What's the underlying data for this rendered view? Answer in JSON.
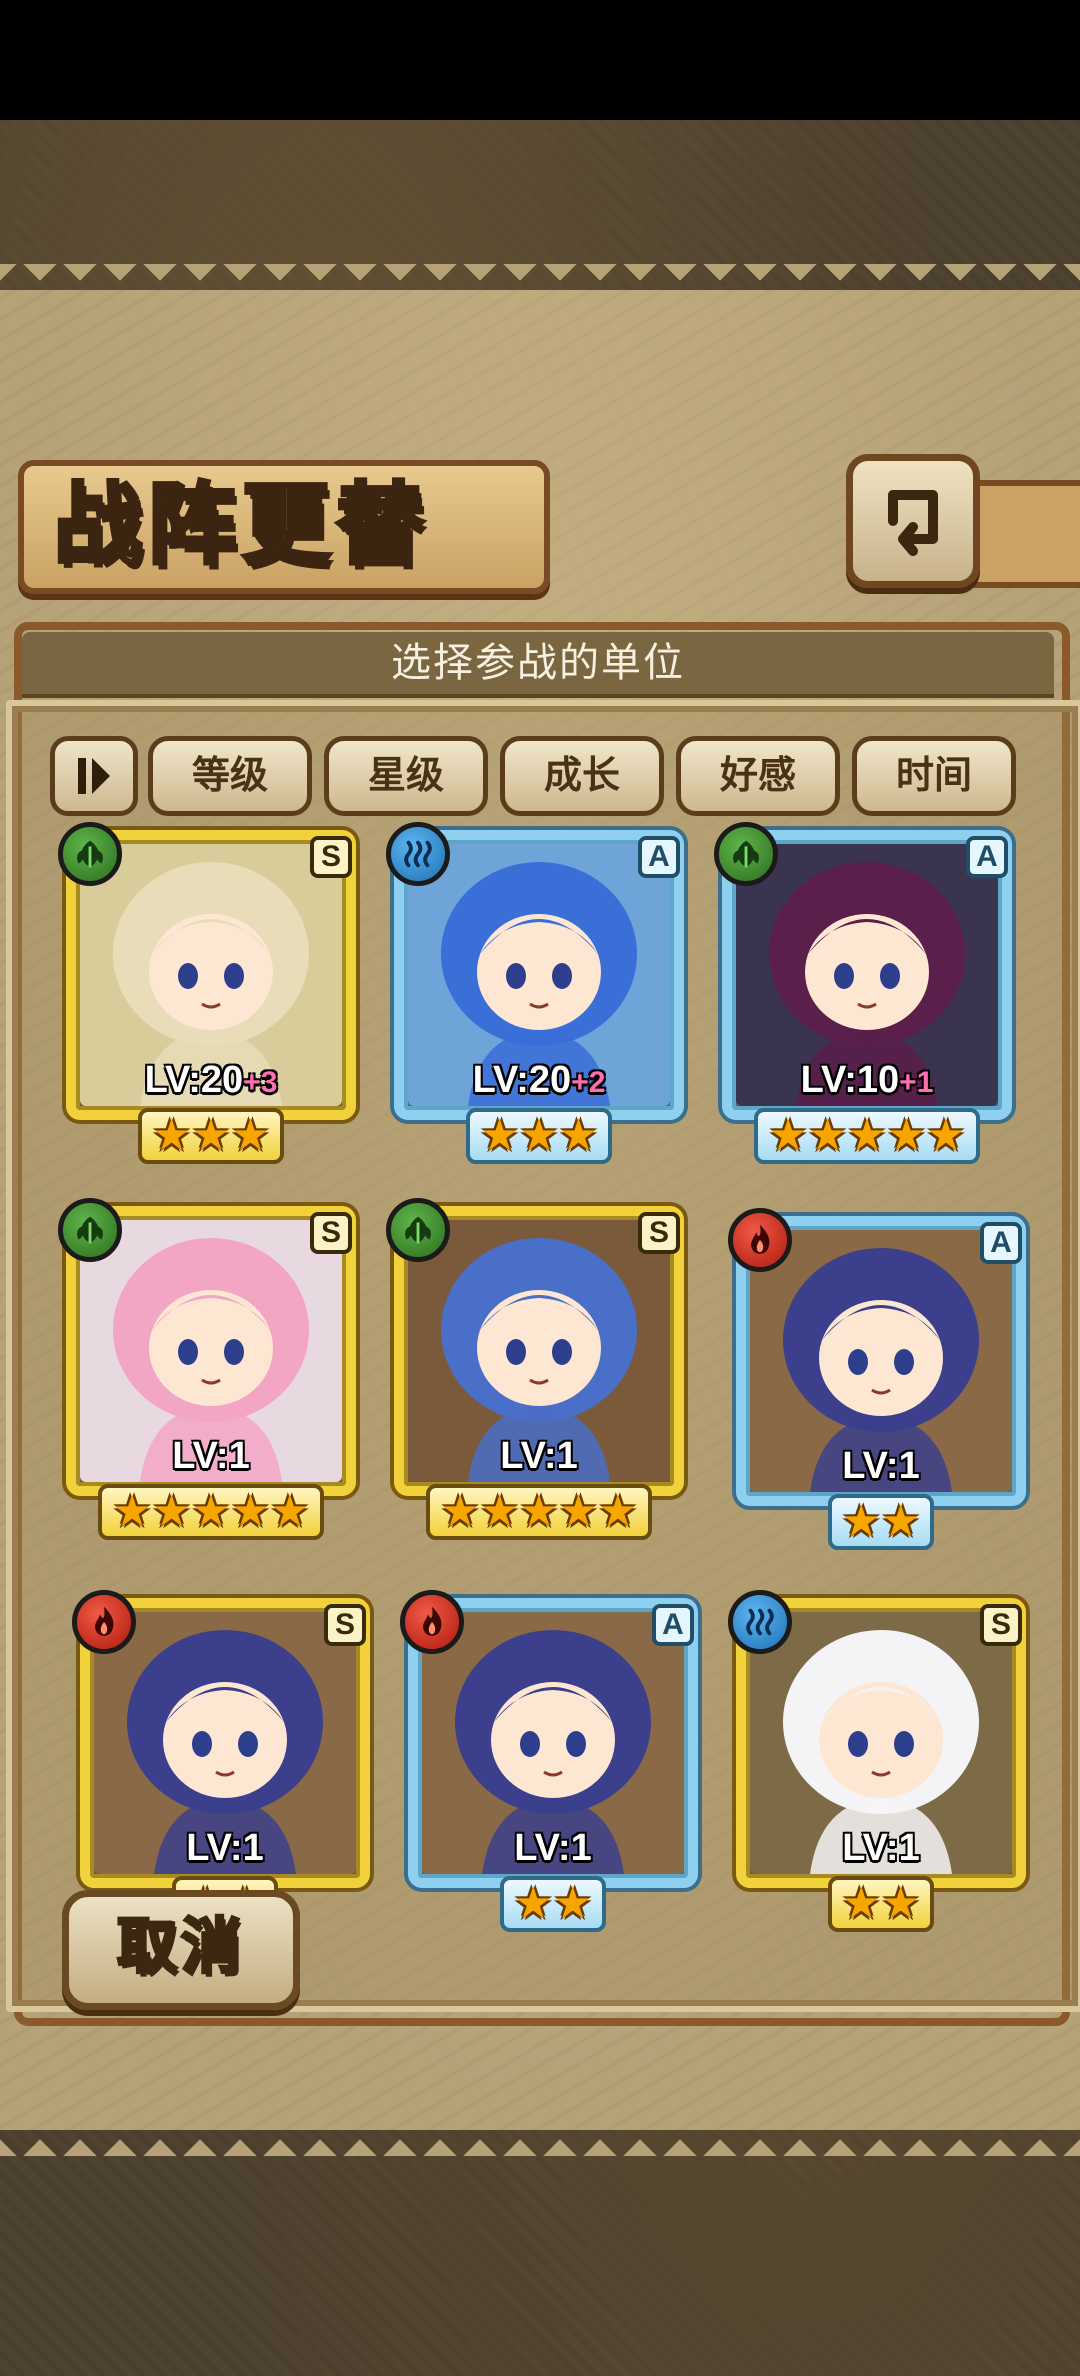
{
  "header": {
    "title": "战阵更替"
  },
  "panel": {
    "subtitle": "选择参战的单位"
  },
  "sort_chips": [
    "等级",
    "星级",
    "成长",
    "好感",
    "时间"
  ],
  "cards": [
    {
      "element": "wood",
      "rank": "S",
      "frame": "gold",
      "level": "LV:20",
      "plus": "+3",
      "stars": 3,
      "star_text": "★★★",
      "hair": "#e9dcb8",
      "bg": "#d8cc9a"
    },
    {
      "element": "water",
      "rank": "A",
      "frame": "blue",
      "level": "LV:20",
      "plus": "+2",
      "stars": 3,
      "star_text": "★★★",
      "hair": "#3a6fd8",
      "bg": "#6fa4d8"
    },
    {
      "element": "wood",
      "rank": "A",
      "frame": "blue",
      "level": "LV:10",
      "plus": "+1",
      "stars": 5,
      "star_text": "★★★★★",
      "hair": "#5a1f4a",
      "bg": "#3b3450"
    },
    {
      "element": "wood",
      "rank": "S",
      "frame": "gold",
      "level": "LV:1",
      "plus": "",
      "stars": 5,
      "star_text": "★★★★★",
      "hair": "#f2a6c4",
      "bg": "#e8d8e0"
    },
    {
      "element": "wood",
      "rank": "S",
      "frame": "gold",
      "level": "LV:1",
      "plus": "",
      "stars": 5,
      "star_text": "★★★★★",
      "hair": "#4a6fc8",
      "bg": "#7a5a3a"
    },
    {
      "element": "fire",
      "rank": "A",
      "frame": "blue",
      "level": "LV:1",
      "plus": "",
      "stars": 2,
      "star_text": "★★",
      "hair": "#3b3f8c",
      "bg": "#8a6a46"
    },
    {
      "element": "fire",
      "rank": "S",
      "frame": "gold",
      "level": "LV:1",
      "plus": "",
      "stars": 2,
      "star_text": "★★",
      "hair": "#3b3f8c",
      "bg": "#8a6a46"
    },
    {
      "element": "fire",
      "rank": "A",
      "frame": "blue",
      "level": "LV:1",
      "plus": "",
      "stars": 2,
      "star_text": "★★",
      "hair": "#3b3f8c",
      "bg": "#8a6a46"
    },
    {
      "element": "water",
      "rank": "S",
      "frame": "gold",
      "level": "LV:1",
      "plus": "",
      "stars": 2,
      "star_text": "★★",
      "hair": "#f4f4f6",
      "bg": "#7d6a46"
    }
  ],
  "buttons": {
    "cancel": "取消"
  },
  "icons": {
    "back": "back-arrow-icon",
    "sort": "sort-toggle-icon",
    "wood": "leaf-element-icon",
    "water": "water-element-icon",
    "fire": "fire-element-icon"
  }
}
